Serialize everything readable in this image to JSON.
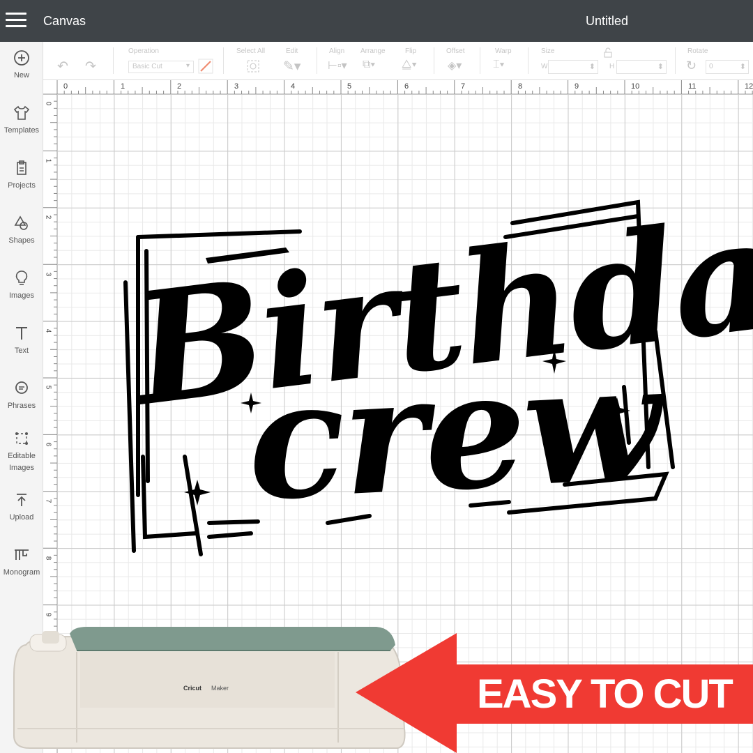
{
  "header": {
    "app_title": "Canvas",
    "doc_title": "Untitled"
  },
  "sidebar": {
    "items": [
      {
        "label": "New",
        "icon": "plus-circle-icon"
      },
      {
        "label": "Templates",
        "icon": "shirt-icon"
      },
      {
        "label": "Projects",
        "icon": "projects-icon"
      },
      {
        "label": "Shapes",
        "icon": "shapes-icon"
      },
      {
        "label": "Images",
        "icon": "lightbulb-icon"
      },
      {
        "label": "Text",
        "icon": "text-icon"
      },
      {
        "label": "Phrases",
        "icon": "speech-bubble-icon"
      },
      {
        "label": "Editable\nImages",
        "icon": "editable-images-icon"
      },
      {
        "label": "Upload",
        "icon": "upload-icon"
      },
      {
        "label": "Monogram",
        "icon": "monogram-icon"
      }
    ]
  },
  "toolbar": {
    "operation_label": "Operation",
    "operation_value": "Basic Cut",
    "select_all_label": "Select All",
    "edit_label": "Edit",
    "align_label": "Align",
    "arrange_label": "Arrange",
    "flip_label": "Flip",
    "offset_label": "Offset",
    "warp_label": "Warp",
    "size_label": "Size",
    "width_label": "W",
    "height_label": "H",
    "rotate_label": "Rotate",
    "rotate_value": "0"
  },
  "ruler": {
    "top_ticks": [
      "0",
      "1",
      "2",
      "3",
      "4",
      "5",
      "6",
      "7",
      "8",
      "9",
      "10",
      "11",
      "12"
    ],
    "left_ticks": [
      "0",
      "1",
      "2",
      "3",
      "4",
      "5",
      "6",
      "7",
      "8",
      "9"
    ]
  },
  "artwork": {
    "line1": "Birthday",
    "line2": "crew"
  },
  "machine": {
    "brand": "Cricut",
    "model": "Maker"
  },
  "promo": {
    "text": "EASY TO CUT",
    "color": "#f03a33"
  },
  "colors": {
    "topbar": "#3f4448",
    "sidebar": "#f4f4f4",
    "machine_lid": "#7f9a8e",
    "machine_body": "#ece7df"
  }
}
